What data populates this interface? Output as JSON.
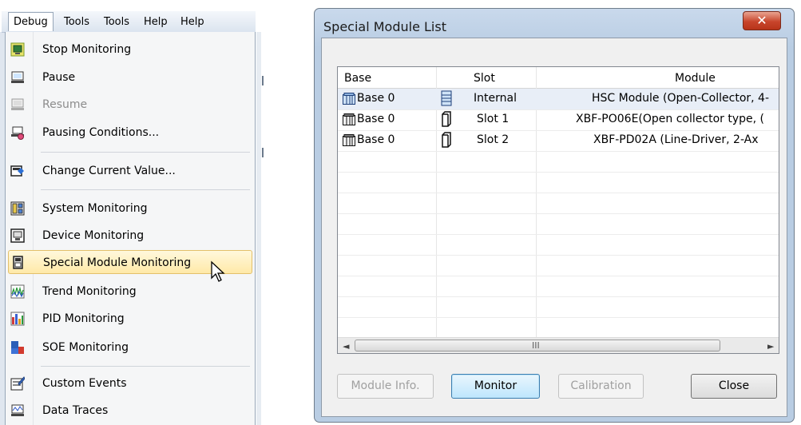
{
  "menubar": {
    "items": [
      "Debug",
      "Tools",
      "Tools",
      "Help",
      "Help"
    ]
  },
  "debug_menu": {
    "items": [
      {
        "label": "Stop Monitoring",
        "icon": "stop-monitoring-icon",
        "enabled": true
      },
      {
        "label": "Pause",
        "icon": "pause-icon",
        "enabled": true
      },
      {
        "label": "Resume",
        "icon": "resume-icon",
        "enabled": false
      },
      {
        "label": "Pausing Conditions...",
        "icon": "pausing-conditions-icon",
        "enabled": true
      },
      {
        "label": "Change Current Value...",
        "icon": "change-value-icon",
        "enabled": true
      },
      {
        "label": "System Monitoring",
        "icon": "system-monitoring-icon",
        "enabled": true
      },
      {
        "label": "Device Monitoring",
        "icon": "device-monitoring-icon",
        "enabled": true
      },
      {
        "label": "Special Module Monitoring",
        "icon": "special-module-icon",
        "enabled": true,
        "highlighted": true
      },
      {
        "label": "Trend Monitoring",
        "icon": "trend-monitoring-icon",
        "enabled": true
      },
      {
        "label": "PID Monitoring",
        "icon": "pid-monitoring-icon",
        "enabled": true
      },
      {
        "label": "SOE Monitoring",
        "icon": "soe-monitoring-icon",
        "enabled": true
      },
      {
        "label": "Custom Events",
        "icon": "custom-events-icon",
        "enabled": true
      },
      {
        "label": "Data Traces",
        "icon": "data-traces-icon",
        "enabled": true
      }
    ]
  },
  "dialog": {
    "title": "Special Module List",
    "close_glyph": "✕",
    "columns": [
      "Base",
      "Slot",
      "Module"
    ],
    "rows": [
      {
        "base": "Base 0",
        "slot": "Internal",
        "module": "HSC Module (Open-Collector, 4-"
      },
      {
        "base": "Base 0",
        "slot": "Slot 1",
        "module": "XBF-PO06E(Open collector type, ("
      },
      {
        "base": "Base 0",
        "slot": "Slot 2",
        "module": "XBF-PD02A (Line-Driver, 2-Ax"
      }
    ],
    "scroll": {
      "left": "◄",
      "right": "►",
      "grip": "III"
    },
    "buttons": {
      "module_info": "Module Info.",
      "monitor": "Monitor",
      "calibration": "Calibration",
      "close": "Close"
    }
  },
  "colors": {
    "highlight": "#ffe9a8",
    "dialog_frame": "#b9cde3",
    "close_button": "#c8452c"
  }
}
